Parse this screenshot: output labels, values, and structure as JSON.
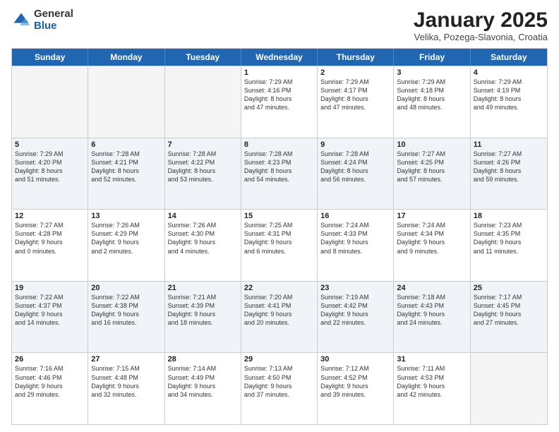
{
  "header": {
    "logo_general": "General",
    "logo_blue": "Blue",
    "month_title": "January 2025",
    "location": "Velika, Pozega-Slavonia, Croatia"
  },
  "days_of_week": [
    "Sunday",
    "Monday",
    "Tuesday",
    "Wednesday",
    "Thursday",
    "Friday",
    "Saturday"
  ],
  "rows": [
    {
      "alt": false,
      "cells": [
        {
          "empty": true,
          "day": "",
          "text": ""
        },
        {
          "empty": true,
          "day": "",
          "text": ""
        },
        {
          "empty": true,
          "day": "",
          "text": ""
        },
        {
          "empty": false,
          "day": "1",
          "text": "Sunrise: 7:29 AM\nSunset: 4:16 PM\nDaylight: 8 hours\nand 47 minutes."
        },
        {
          "empty": false,
          "day": "2",
          "text": "Sunrise: 7:29 AM\nSunset: 4:17 PM\nDaylight: 8 hours\nand 47 minutes."
        },
        {
          "empty": false,
          "day": "3",
          "text": "Sunrise: 7:29 AM\nSunset: 4:18 PM\nDaylight: 8 hours\nand 48 minutes."
        },
        {
          "empty": false,
          "day": "4",
          "text": "Sunrise: 7:29 AM\nSunset: 4:19 PM\nDaylight: 8 hours\nand 49 minutes."
        }
      ]
    },
    {
      "alt": true,
      "cells": [
        {
          "empty": false,
          "day": "5",
          "text": "Sunrise: 7:29 AM\nSunset: 4:20 PM\nDaylight: 8 hours\nand 51 minutes."
        },
        {
          "empty": false,
          "day": "6",
          "text": "Sunrise: 7:28 AM\nSunset: 4:21 PM\nDaylight: 8 hours\nand 52 minutes."
        },
        {
          "empty": false,
          "day": "7",
          "text": "Sunrise: 7:28 AM\nSunset: 4:22 PM\nDaylight: 8 hours\nand 53 minutes."
        },
        {
          "empty": false,
          "day": "8",
          "text": "Sunrise: 7:28 AM\nSunset: 4:23 PM\nDaylight: 8 hours\nand 54 minutes."
        },
        {
          "empty": false,
          "day": "9",
          "text": "Sunrise: 7:28 AM\nSunset: 4:24 PM\nDaylight: 8 hours\nand 56 minutes."
        },
        {
          "empty": false,
          "day": "10",
          "text": "Sunrise: 7:27 AM\nSunset: 4:25 PM\nDaylight: 8 hours\nand 57 minutes."
        },
        {
          "empty": false,
          "day": "11",
          "text": "Sunrise: 7:27 AM\nSunset: 4:26 PM\nDaylight: 8 hours\nand 59 minutes."
        }
      ]
    },
    {
      "alt": false,
      "cells": [
        {
          "empty": false,
          "day": "12",
          "text": "Sunrise: 7:27 AM\nSunset: 4:28 PM\nDaylight: 9 hours\nand 0 minutes."
        },
        {
          "empty": false,
          "day": "13",
          "text": "Sunrise: 7:26 AM\nSunset: 4:29 PM\nDaylight: 9 hours\nand 2 minutes."
        },
        {
          "empty": false,
          "day": "14",
          "text": "Sunrise: 7:26 AM\nSunset: 4:30 PM\nDaylight: 9 hours\nand 4 minutes."
        },
        {
          "empty": false,
          "day": "15",
          "text": "Sunrise: 7:25 AM\nSunset: 4:31 PM\nDaylight: 9 hours\nand 6 minutes."
        },
        {
          "empty": false,
          "day": "16",
          "text": "Sunrise: 7:24 AM\nSunset: 4:33 PM\nDaylight: 9 hours\nand 8 minutes."
        },
        {
          "empty": false,
          "day": "17",
          "text": "Sunrise: 7:24 AM\nSunset: 4:34 PM\nDaylight: 9 hours\nand 9 minutes."
        },
        {
          "empty": false,
          "day": "18",
          "text": "Sunrise: 7:23 AM\nSunset: 4:35 PM\nDaylight: 9 hours\nand 11 minutes."
        }
      ]
    },
    {
      "alt": true,
      "cells": [
        {
          "empty": false,
          "day": "19",
          "text": "Sunrise: 7:22 AM\nSunset: 4:37 PM\nDaylight: 9 hours\nand 14 minutes."
        },
        {
          "empty": false,
          "day": "20",
          "text": "Sunrise: 7:22 AM\nSunset: 4:38 PM\nDaylight: 9 hours\nand 16 minutes."
        },
        {
          "empty": false,
          "day": "21",
          "text": "Sunrise: 7:21 AM\nSunset: 4:39 PM\nDaylight: 9 hours\nand 18 minutes."
        },
        {
          "empty": false,
          "day": "22",
          "text": "Sunrise: 7:20 AM\nSunset: 4:41 PM\nDaylight: 9 hours\nand 20 minutes."
        },
        {
          "empty": false,
          "day": "23",
          "text": "Sunrise: 7:19 AM\nSunset: 4:42 PM\nDaylight: 9 hours\nand 22 minutes."
        },
        {
          "empty": false,
          "day": "24",
          "text": "Sunrise: 7:18 AM\nSunset: 4:43 PM\nDaylight: 9 hours\nand 24 minutes."
        },
        {
          "empty": false,
          "day": "25",
          "text": "Sunrise: 7:17 AM\nSunset: 4:45 PM\nDaylight: 9 hours\nand 27 minutes."
        }
      ]
    },
    {
      "alt": false,
      "cells": [
        {
          "empty": false,
          "day": "26",
          "text": "Sunrise: 7:16 AM\nSunset: 4:46 PM\nDaylight: 9 hours\nand 29 minutes."
        },
        {
          "empty": false,
          "day": "27",
          "text": "Sunrise: 7:15 AM\nSunset: 4:48 PM\nDaylight: 9 hours\nand 32 minutes."
        },
        {
          "empty": false,
          "day": "28",
          "text": "Sunrise: 7:14 AM\nSunset: 4:49 PM\nDaylight: 9 hours\nand 34 minutes."
        },
        {
          "empty": false,
          "day": "29",
          "text": "Sunrise: 7:13 AM\nSunset: 4:50 PM\nDaylight: 9 hours\nand 37 minutes."
        },
        {
          "empty": false,
          "day": "30",
          "text": "Sunrise: 7:12 AM\nSunset: 4:52 PM\nDaylight: 9 hours\nand 39 minutes."
        },
        {
          "empty": false,
          "day": "31",
          "text": "Sunrise: 7:11 AM\nSunset: 4:53 PM\nDaylight: 9 hours\nand 42 minutes."
        },
        {
          "empty": true,
          "day": "",
          "text": ""
        }
      ]
    }
  ]
}
